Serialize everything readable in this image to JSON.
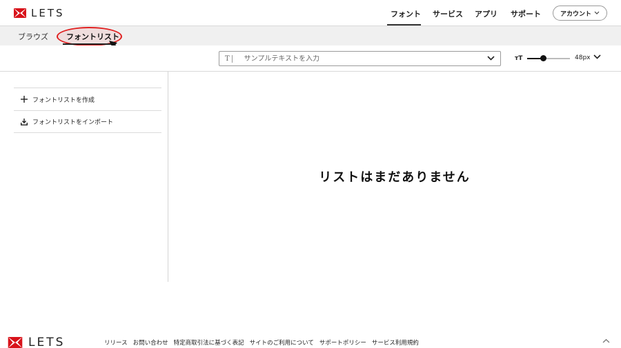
{
  "header": {
    "logo_text": "LETS",
    "nav": [
      {
        "label": "フォント",
        "active": true
      },
      {
        "label": "サービス",
        "active": false
      },
      {
        "label": "アプリ",
        "active": false
      },
      {
        "label": "サポート",
        "active": false
      }
    ],
    "account_label": "アカウント",
    "account_icon": "chevron-down-icon"
  },
  "subnav": {
    "items": [
      {
        "label": "ブラウズ",
        "active": false
      },
      {
        "label": "フォントリスト",
        "active": true
      }
    ],
    "highlight_color": "#e02020"
  },
  "toolbar": {
    "sample_icon": "text-cursor-icon",
    "sample_placeholder": "サンプルテキストを入力",
    "sample_icon_glyph": "T",
    "size_icon_glyph": "тT",
    "size_value": "48px",
    "size_slider_fraction": 0.37
  },
  "sidebar": {
    "items": [
      {
        "label": "フォントリストを作成",
        "icon": "plus-icon"
      },
      {
        "label": "フォントリストをインポート",
        "icon": "import-icon"
      }
    ]
  },
  "main": {
    "empty_message": "リストはまだありません"
  },
  "footer": {
    "logo_text": "LETS",
    "links": [
      "リリース",
      "お問い合わせ",
      "特定商取引法に基づく表記",
      "サイトのご利用について",
      "サポートポリシー",
      "サービス利用規約"
    ],
    "back_to_top_icon": "chevron-up-icon"
  },
  "colors": {
    "brand_red": "#d8121a",
    "annotation_red": "#e02020",
    "subnav_bg": "#f0f0f0"
  }
}
